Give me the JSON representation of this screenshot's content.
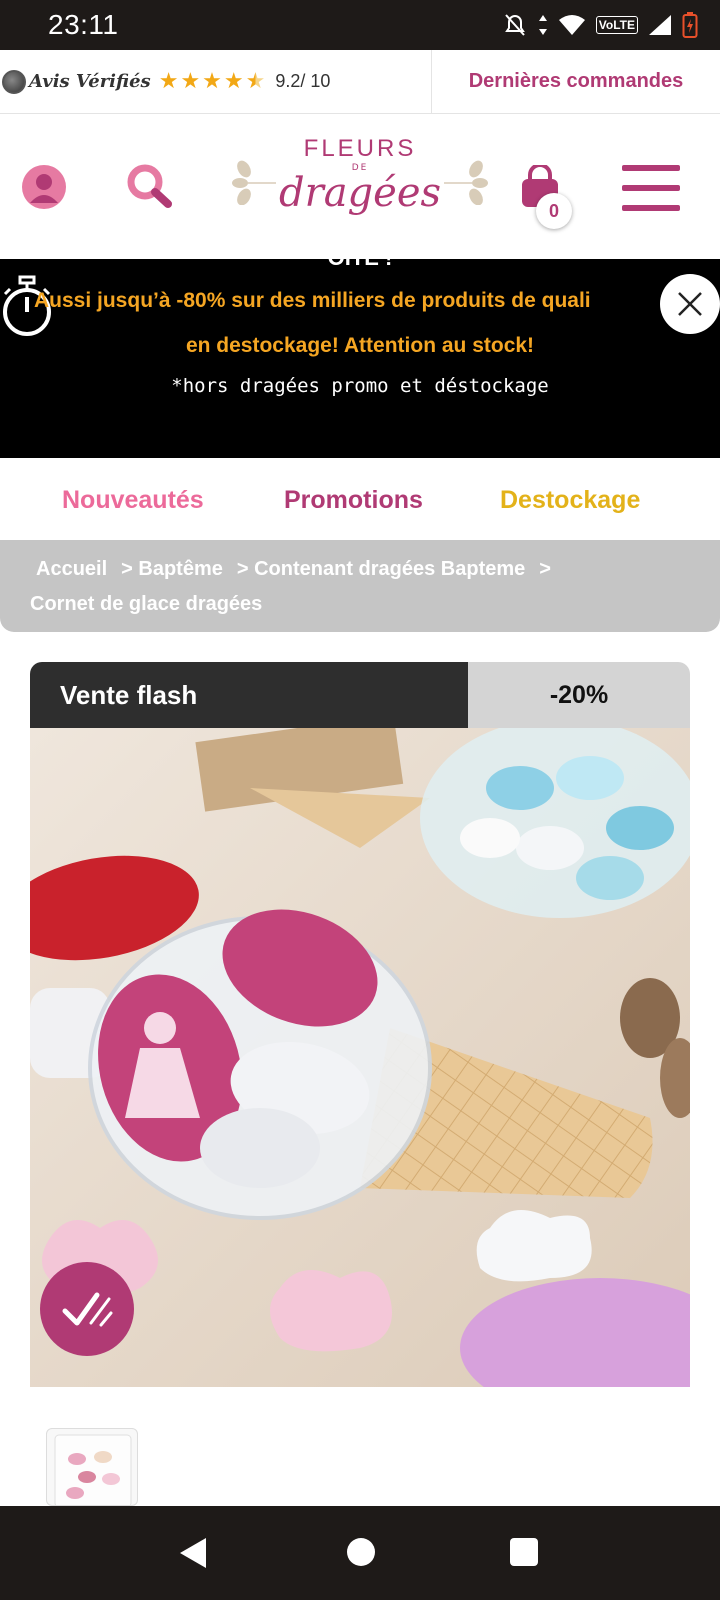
{
  "status_bar": {
    "time": "23:11",
    "volte": "VoLTE",
    "icons": [
      "mute-icon",
      "data-arrows-icon",
      "wifi-icon",
      "volte-icon",
      "signal-icon",
      "battery-low-icon"
    ]
  },
  "review_bar": {
    "brand": "Avis Vérifiés",
    "rating": "9.2/ 10",
    "stars": 4.5,
    "recent_orders": "Dernières commandes"
  },
  "header": {
    "logo_top": "FLEURS",
    "logo_mid": "DE",
    "logo_bottom": "dragées",
    "cart_count": "0",
    "accent": "#b03a74"
  },
  "promo": {
    "cut_text": "OITE !",
    "line1": "Aussi jusqu’à -80% sur des milliers de produits de quali",
    "line2": "en destockage! Attention au stock!",
    "line3": "*hors dragées promo et déstockage"
  },
  "nav_tabs": [
    {
      "label": "Nouveautés",
      "color": "#ec6a9a"
    },
    {
      "label": "Promotions",
      "color": "#b03a74"
    },
    {
      "label": "Destockage",
      "color": "#e3b21a"
    }
  ],
  "breadcrumb": {
    "items": [
      "Accueil",
      "> Baptême",
      "> Contenant dragées Bapteme",
      ">"
    ],
    "current": "Cornet de glace dragées"
  },
  "product": {
    "flash_label": "Vente flash",
    "discount": "-20%"
  }
}
